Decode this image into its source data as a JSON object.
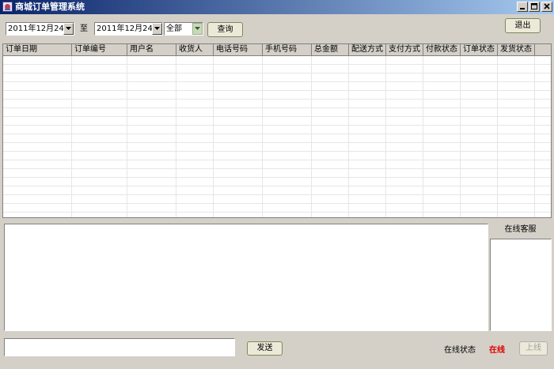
{
  "window": {
    "title": "商城订单管理系统"
  },
  "filters": {
    "start_date": "2011年12月24日",
    "to_label": "至",
    "end_date": "2011年12月24日",
    "status_value": "全部",
    "query_label": "查询",
    "exit_label": "退出"
  },
  "grid": {
    "columns": [
      "订单日期",
      "订单编号",
      "用户名",
      "收货人",
      "电话号码",
      "手机号码",
      "总金额",
      "配送方式",
      "支付方式",
      "付款状态",
      "订单状态",
      "发货状态"
    ]
  },
  "chat": {
    "service_header": "在线客服",
    "message_value": "",
    "send_label": "发送",
    "online_status_label": "在线状态",
    "online_status_value": "在线",
    "go_online_label": "上线"
  },
  "colors": {
    "status_online": "#e00000"
  }
}
